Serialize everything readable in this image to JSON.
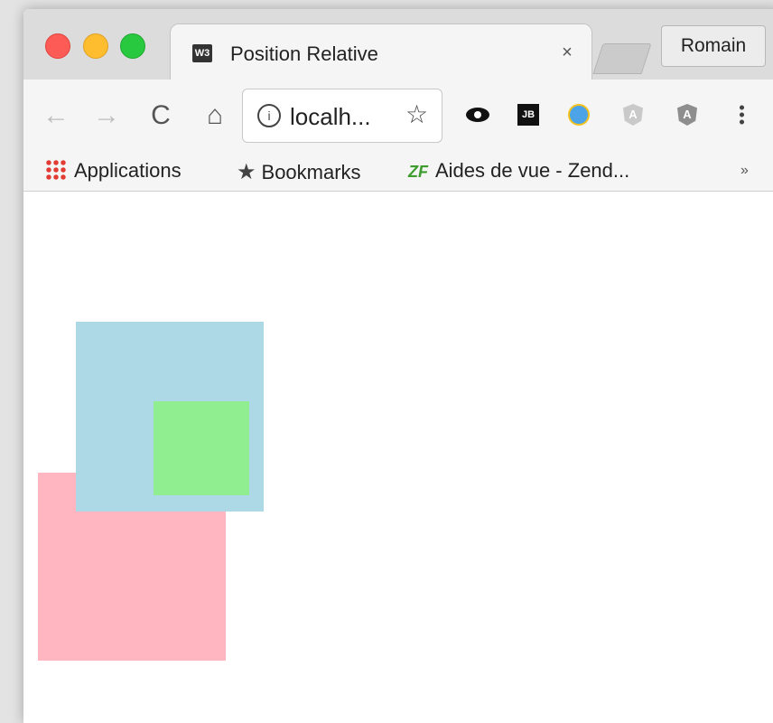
{
  "tab": {
    "favicon_text": "W3",
    "title": "Position Relative",
    "close_symbol": "×"
  },
  "profile": {
    "name": "Romain"
  },
  "toolbar": {
    "back_symbol": "←",
    "forward_symbol": "→",
    "reload_symbol": "C",
    "home_symbol": "⌂",
    "address_text": "localh...",
    "info_symbol": "i",
    "star_symbol": "☆"
  },
  "extensions": [
    {
      "name": "eye-extension-icon"
    },
    {
      "name": "jetbrains-extension-icon",
      "text": "JB"
    },
    {
      "name": "alarm-clock-extension-icon"
    },
    {
      "name": "angular-extension-icon-light",
      "text": "A"
    },
    {
      "name": "angular-extension-icon-dark",
      "text": "A"
    },
    {
      "name": "menu-kebab-icon"
    }
  ],
  "bookmarks": {
    "apps_label": "Applications",
    "bookmarks_label": "Bookmarks",
    "zend_icon_text": "ZF",
    "zend_label": "Aides de vue - Zend...",
    "more_symbol": "»"
  },
  "page": {
    "boxes": [
      {
        "name": "pink-box",
        "color": "#ffb6c1"
      },
      {
        "name": "blue-box",
        "color": "#add8e6"
      },
      {
        "name": "green-box",
        "color": "#90ee90"
      }
    ]
  },
  "colors": {
    "traffic_close": "#fd5b55",
    "traffic_minimize": "#fdbd2f",
    "traffic_maximize": "#28c83f"
  }
}
